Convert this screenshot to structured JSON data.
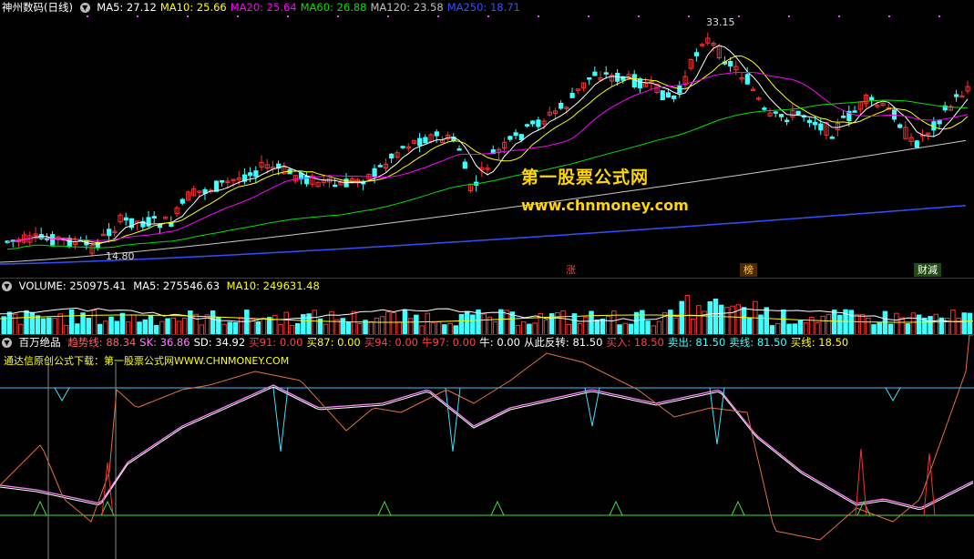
{
  "main_panel": {
    "title": "神州数码(日线)",
    "ma_indicators": [
      {
        "label": "MA5: 27.12",
        "color": "#ffffff"
      },
      {
        "label": "MA10: 25.66",
        "color": "#ffff00"
      },
      {
        "label": "MA20: 25.64",
        "color": "#ff00ff"
      },
      {
        "label": "MA60: 26.88",
        "color": "#00e000"
      },
      {
        "label": "MA120: 23.58",
        "color": "#c0c0c0"
      },
      {
        "label": "MA250: 18.71",
        "color": "#3050ff"
      }
    ],
    "high_label": "33.15",
    "low_label": "14.80",
    "watermark_title": "第一股票公式网",
    "watermark_url": "www.chnmoney.com",
    "event_tags": [
      "涨",
      "榜",
      "财減"
    ]
  },
  "volume_panel": {
    "title": "VOLUME: 250975.41",
    "ma5": "MA5: 275546.63",
    "ma10": "MA10: 249631.48"
  },
  "indicator_panel": {
    "name": "百万绝品",
    "values": [
      {
        "label": "趋势线: 88.34",
        "color": "#ff6060"
      },
      {
        "label": "SK: 36.86",
        "color": "#ff80ff"
      },
      {
        "label": "SD: 34.92",
        "color": "#ffffff"
      },
      {
        "label": "买91: 0.00",
        "color": "#ff4040"
      },
      {
        "label": "买87: 0.00",
        "color": "#ffff00"
      },
      {
        "label": "买94: 0.00",
        "color": "#ff4040"
      },
      {
        "label": "牛97: 0.00",
        "color": "#ff4040"
      },
      {
        "label": "牛: 0.00",
        "color": "#ffffff"
      },
      {
        "label": "从此反转: 81.50",
        "color": "#ffffff"
      },
      {
        "label": "买入: 18.50",
        "color": "#ff4040"
      },
      {
        "label": "卖出: 81.50",
        "color": "#40ffff"
      },
      {
        "label": "卖线: 81.50",
        "color": "#40ffff"
      },
      {
        "label": "买线: 18.50",
        "color": "#ffff00"
      }
    ],
    "note": "通达信原创公式下载：第一股票公式网WWW.CHNMONEY.COM"
  },
  "colors": {
    "up": "#ff3030",
    "down": "#40ffff",
    "separator": "#8b1a1a"
  }
}
